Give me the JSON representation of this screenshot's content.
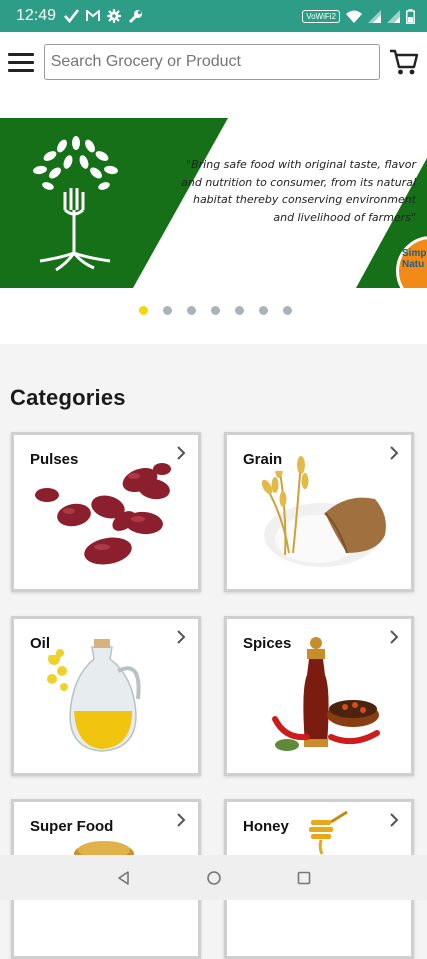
{
  "status_bar": {
    "time": "12:49",
    "left_icons": [
      "check-icon",
      "gmail-icon",
      "gear-icon",
      "wrench-icon"
    ],
    "volte_label": "VoWiFi2",
    "right_icons": [
      "wifi-icon",
      "signal-icon",
      "signal-icon-2",
      "battery-icon"
    ],
    "background_color": "#2e9d87"
  },
  "header": {
    "search_placeholder": "Search Grocery or Product",
    "menu_icon": "hamburger-menu-icon",
    "cart_icon": "shopping-cart-icon"
  },
  "banner": {
    "quote": "\"Bring safe food with original taste, flavor and nutrition to consumer, from its natural habitat thereby conserving environment and livelihood of farmers\"",
    "brand_text": "Simp Natu",
    "brand_color": "#157018",
    "dots_count": 7,
    "active_dot": 0
  },
  "categories": {
    "title": "Categories",
    "items": [
      {
        "label": "Pulses",
        "icon": "kidney-beans-image"
      },
      {
        "label": "Grain",
        "icon": "wheat-flour-image"
      },
      {
        "label": "Oil",
        "icon": "oil-jug-image"
      },
      {
        "label": "Spices",
        "icon": "pepper-grinder-image"
      },
      {
        "label": "Super Food",
        "icon": "millet-bowl-image"
      },
      {
        "label": "Honey",
        "icon": "honey-dipper-image"
      }
    ]
  },
  "nav_bar": {
    "icons": [
      "back-icon",
      "home-icon",
      "recents-icon"
    ]
  }
}
